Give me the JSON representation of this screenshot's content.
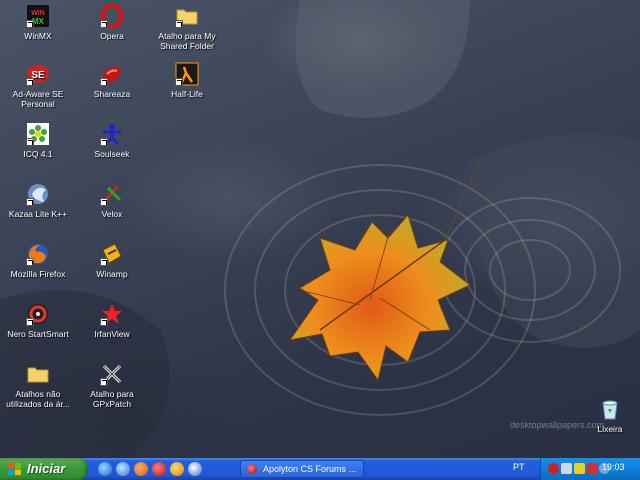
{
  "desktop": {
    "icons": [
      {
        "label": "WinMX",
        "icon": "winmx-icon"
      },
      {
        "label": "Opera",
        "icon": "opera-icon"
      },
      {
        "label": "Atalho para My Shared Folder",
        "icon": "folder-shortcut-icon"
      },
      {
        "label": "Ad-Aware SE Personal",
        "icon": "adaware-icon"
      },
      {
        "label": "Shareaza",
        "icon": "shareaza-icon"
      },
      {
        "label": "Half-Life",
        "icon": "half-life-icon"
      },
      {
        "label": "ICQ 4.1",
        "icon": "icq-icon"
      },
      {
        "label": "Soulseek",
        "icon": "soulseek-icon"
      },
      {
        "label": "Kazaa Lite K++",
        "icon": "kazaa-icon"
      },
      {
        "label": "Velox",
        "icon": "velox-icon"
      },
      {
        "label": "Mozilla Firefox",
        "icon": "firefox-icon"
      },
      {
        "label": "Winamp",
        "icon": "winamp-icon"
      },
      {
        "label": "Nero StartSmart",
        "icon": "nero-icon"
      },
      {
        "label": "IrfanView",
        "icon": "irfanview-icon"
      },
      {
        "label": "Atalhos não utilizados da ár...",
        "icon": "folder-icon"
      },
      {
        "label": "Atalho para GPxPatch",
        "icon": "gpxpatch-icon"
      },
      {
        "label": "Lixeira",
        "icon": "recycle-bin-icon"
      }
    ],
    "watermark": "desktopwallpapers.com"
  },
  "taskbar": {
    "start_label": "Iniciar",
    "quicklaunch": [
      "ie-icon",
      "messenger-icon",
      "firefox-icon",
      "opera-icon",
      "winamp-icon",
      "media-player-icon"
    ],
    "task_button": "Apolyton CS Forums ...",
    "language": "PT",
    "tray_icons": [
      "antivirus-icon",
      "network-icon",
      "zonealarm-icon",
      "shield-icon",
      "messenger-tray-icon"
    ],
    "clock": "19:03"
  },
  "colors": {
    "taskbar_blue": "#245edb",
    "start_green": "#3c9c3c",
    "tray_blue": "#0f7fd8"
  }
}
